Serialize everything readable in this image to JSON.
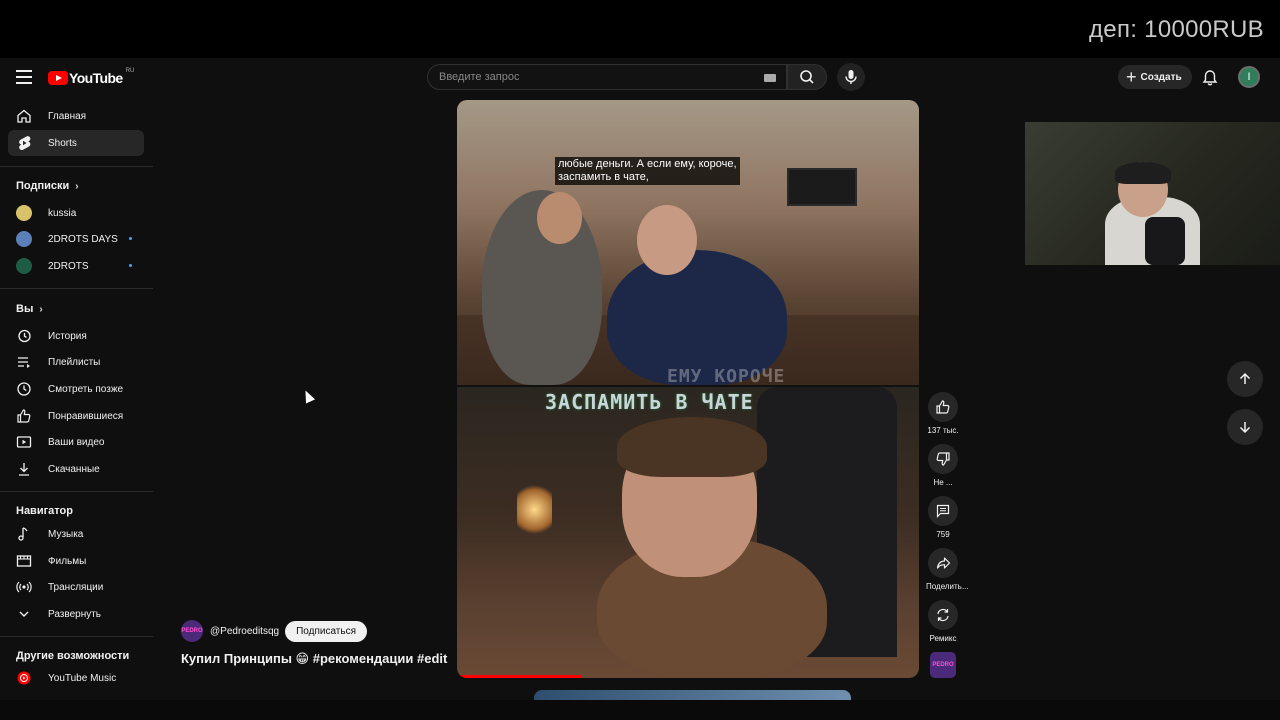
{
  "stream": {
    "deposit": "деп: 10000RUB"
  },
  "header": {
    "logo_text": "YouTube",
    "region": "RU",
    "search_placeholder": "Введите запрос",
    "create_label": "Создать",
    "avatar_letter": "I"
  },
  "sidebar": {
    "main": [
      {
        "label": "Главная",
        "icon": "home-icon"
      },
      {
        "label": "Shorts",
        "icon": "shorts-icon",
        "active": true
      }
    ],
    "subscriptions_title": "Подписки",
    "subscriptions": [
      {
        "label": "kussia"
      },
      {
        "label": "2DROTS DAYS"
      },
      {
        "label": "2DROTS"
      }
    ],
    "you_title": "Вы",
    "you": [
      {
        "label": "История",
        "icon": "history-icon"
      },
      {
        "label": "Плейлисты",
        "icon": "playlists-icon"
      },
      {
        "label": "Смотреть позже",
        "icon": "watch-later-icon"
      },
      {
        "label": "Понравившиеся",
        "icon": "liked-icon"
      },
      {
        "label": "Ваши видео",
        "icon": "your-videos-icon"
      },
      {
        "label": "Скачанные",
        "icon": "download-icon"
      }
    ],
    "navigator_title": "Навигатор",
    "navigator": [
      {
        "label": "Музыка",
        "icon": "music-icon"
      },
      {
        "label": "Фильмы",
        "icon": "movies-icon"
      },
      {
        "label": "Трансляции",
        "icon": "live-icon"
      },
      {
        "label": "Развернуть",
        "icon": "chevron-down-icon"
      }
    ],
    "more_title": "Другие возможности",
    "more": [
      {
        "label": "YouTube Music",
        "icon": "youtube-music-icon"
      }
    ]
  },
  "short": {
    "caption_line1": "любые деньги. А если ему, короче,",
    "caption_line2": "заспамить в чате,",
    "overlay_top": "ЕМУ КОРОЧЕ",
    "overlay_main": "ЗАСПАМИТЬ В ЧАТЕ",
    "progress_fraction": 0.27,
    "channel_logo_text": "PEDRO",
    "channel": "@Pedroeditsqg",
    "subscribe_label": "Подписаться",
    "title": "Купил Принципы 😁 #рекомендации #edit"
  },
  "actions": {
    "likes": "137 тыс.",
    "dislike": "Не ...",
    "comments": "759",
    "share": "Поделить...",
    "remix": "Ремикс"
  },
  "colors": {
    "accent": "#ff0000",
    "background": "#0f0f0f",
    "chip": "#272727",
    "unread_dot": "#3ea6ff"
  }
}
